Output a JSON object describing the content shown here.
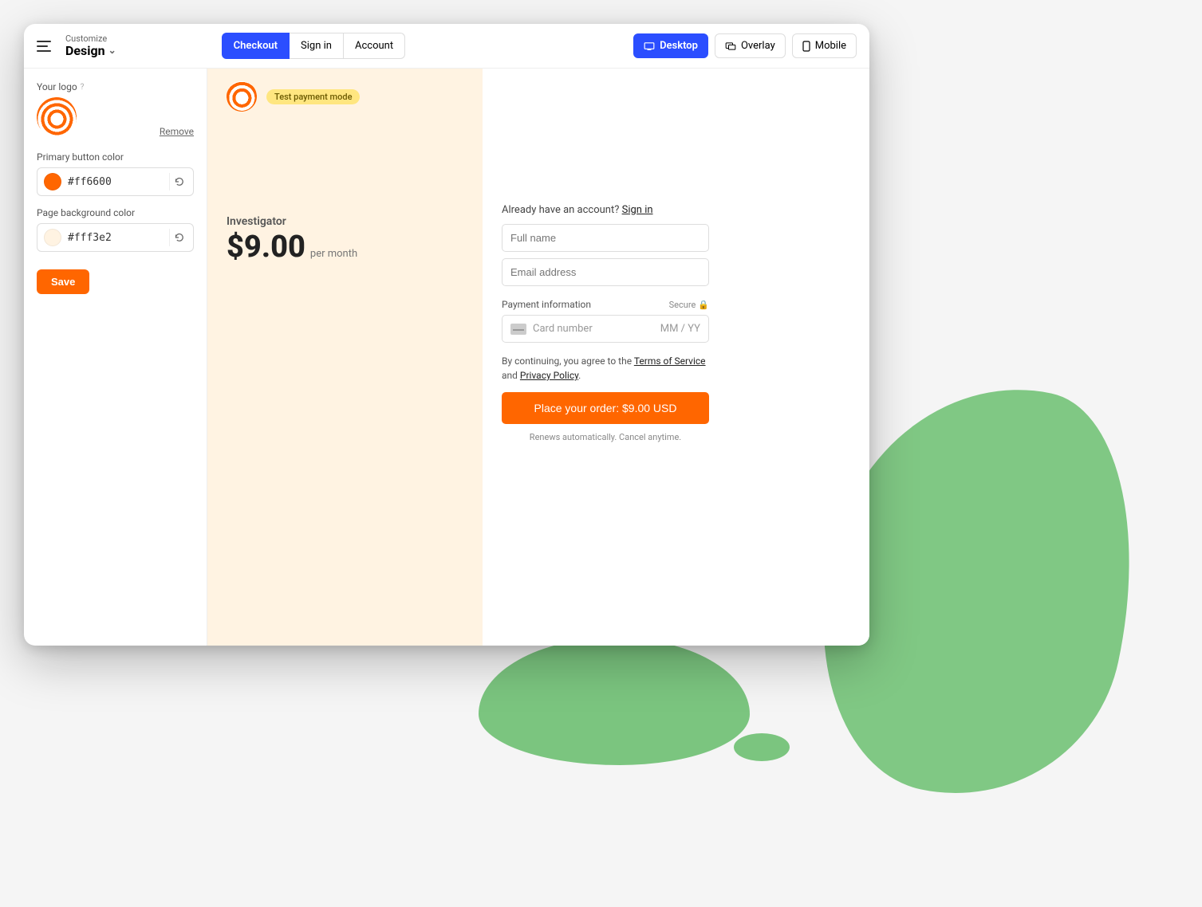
{
  "header": {
    "breadcrumb_top": "Customize",
    "breadcrumb_main": "Design",
    "page_tabs": [
      "Checkout",
      "Sign in",
      "Account"
    ],
    "page_tab_active": 0,
    "view_tabs": [
      "Desktop",
      "Overlay",
      "Mobile"
    ],
    "view_tab_active": 0
  },
  "sidebar": {
    "logo_label": "Your logo",
    "remove_label": "Remove",
    "primary_color_label": "Primary button color",
    "primary_color_value": "#ff6600",
    "bg_color_label": "Page background color",
    "bg_color_value": "#fff3e2",
    "save_label": "Save"
  },
  "preview": {
    "test_badge": "Test payment mode",
    "product_name": "Investigator",
    "price": "$9.00",
    "period": "per month",
    "already_text": "Already have an account? ",
    "signin_link": "Sign in",
    "full_name_placeholder": "Full name",
    "email_placeholder": "Email address",
    "payment_label": "Payment information",
    "secure_label": "Secure",
    "card_placeholder": "Card number",
    "card_exp_placeholder": "MM / YY",
    "terms_prefix": "By continuing, you agree to the ",
    "terms_link": "Terms of Service",
    "terms_mid": " and ",
    "privacy_link": "Privacy Policy",
    "terms_suffix": ".",
    "place_order_label": "Place your order: $9.00 USD",
    "renew_note": "Renews automatically. Cancel anytime."
  },
  "colors": {
    "accent": "#ff6600",
    "page_bg": "#fff3e2",
    "primary_blue": "#2b4eff"
  }
}
